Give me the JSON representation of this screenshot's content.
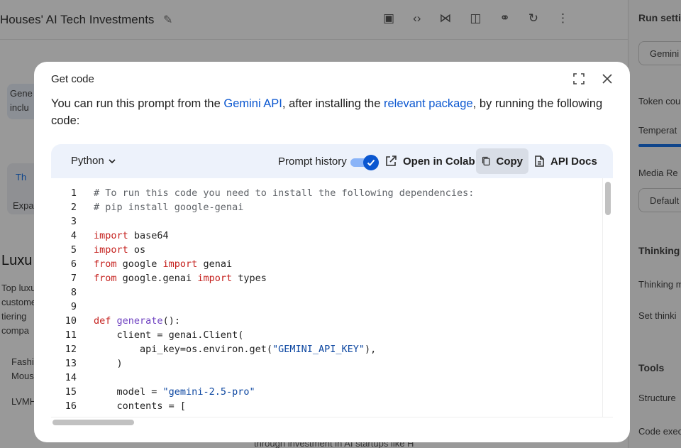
{
  "background": {
    "title": "Houses' AI Tech Investments",
    "right_panel": {
      "heading": "Run setti",
      "model": "Gemini",
      "token_count": "Token cou",
      "temperature": "Temperat",
      "media_resolution": "Media Re",
      "media_default": "Default",
      "thinking": "Thinking",
      "thinking_mode": "Thinking m",
      "set_thinking": "Set thinki",
      "tools": "Tools",
      "structured": "Structure",
      "code_exec": "Code exec"
    },
    "left": {
      "box1_line1": "Gene",
      "box1_line2": "inclu",
      "chip": "Th",
      "expand": "Expa",
      "heading": "Luxu",
      "p1": "Top luxu",
      "p2": "custome",
      "p3": "tiering",
      "p4": "compa",
      "p5": "Fashi",
      "p6": "Mous",
      "p7": "LVMH"
    },
    "bottom_text": "through investment in AI startups like H"
  },
  "modal": {
    "title": "Get code",
    "description": {
      "part1": "You can run this prompt from the ",
      "link1": "Gemini API",
      "part2": ", after installing the ",
      "link2": "relevant package",
      "part3": ", by running the following code:"
    },
    "toolbar": {
      "language": "Python",
      "prompt_history_label": "Prompt history",
      "prompt_history_on": true,
      "open_in_colab": "Open in Colab",
      "copy": "Copy",
      "api_docs": "API Docs"
    },
    "code_lines": [
      {
        "n": "1",
        "tokens": [
          {
            "t": "# To run this code you need to install the following dependencies:",
            "k": "comment"
          }
        ]
      },
      {
        "n": "2",
        "tokens": [
          {
            "t": "# pip install google-genai",
            "k": "comment"
          }
        ]
      },
      {
        "n": "3",
        "tokens": []
      },
      {
        "n": "4",
        "tokens": [
          {
            "t": "import",
            "k": "kw"
          },
          {
            "t": " base64",
            "k": ""
          }
        ]
      },
      {
        "n": "5",
        "tokens": [
          {
            "t": "import",
            "k": "kw"
          },
          {
            "t": " os",
            "k": ""
          }
        ]
      },
      {
        "n": "6",
        "tokens": [
          {
            "t": "from",
            "k": "kw"
          },
          {
            "t": " google ",
            "k": ""
          },
          {
            "t": "import",
            "k": "kw"
          },
          {
            "t": " genai",
            "k": ""
          }
        ]
      },
      {
        "n": "7",
        "tokens": [
          {
            "t": "from",
            "k": "kw"
          },
          {
            "t": " google.genai ",
            "k": ""
          },
          {
            "t": "import",
            "k": "kw"
          },
          {
            "t": " types",
            "k": ""
          }
        ]
      },
      {
        "n": "8",
        "tokens": []
      },
      {
        "n": "9",
        "tokens": []
      },
      {
        "n": "10",
        "tokens": [
          {
            "t": "def",
            "k": "kw"
          },
          {
            "t": " ",
            "k": ""
          },
          {
            "t": "generate",
            "k": "fn"
          },
          {
            "t": "():",
            "k": ""
          }
        ]
      },
      {
        "n": "11",
        "tokens": [
          {
            "t": "    client = genai.Client(",
            "k": ""
          }
        ]
      },
      {
        "n": "12",
        "tokens": [
          {
            "t": "        api_key=os.environ.get(",
            "k": ""
          },
          {
            "t": "\"GEMINI_API_KEY\"",
            "k": "str"
          },
          {
            "t": "),",
            "k": ""
          }
        ]
      },
      {
        "n": "13",
        "tokens": [
          {
            "t": "    )",
            "k": ""
          }
        ]
      },
      {
        "n": "14",
        "tokens": []
      },
      {
        "n": "15",
        "tokens": [
          {
            "t": "    model = ",
            "k": ""
          },
          {
            "t": "\"gemini-2.5-pro\"",
            "k": "str"
          }
        ]
      },
      {
        "n": "16",
        "tokens": [
          {
            "t": "    contents = [",
            "k": ""
          }
        ]
      }
    ]
  },
  "colors": {
    "accent": "#0b57d0",
    "code_keyword": "#c5221f",
    "code_function": "#6f42c1",
    "code_string": "#0d47a1",
    "code_comment": "#5f6368",
    "panel_bg": "#edf2fb"
  },
  "icons": {
    "edit": "pencil-icon",
    "fullscreen": "fullscreen-icon",
    "close": "close-icon",
    "dropdown": "chevron-down-icon",
    "external": "open-external-icon",
    "copy": "copy-icon",
    "docs": "document-icon",
    "check": "check-icon"
  }
}
